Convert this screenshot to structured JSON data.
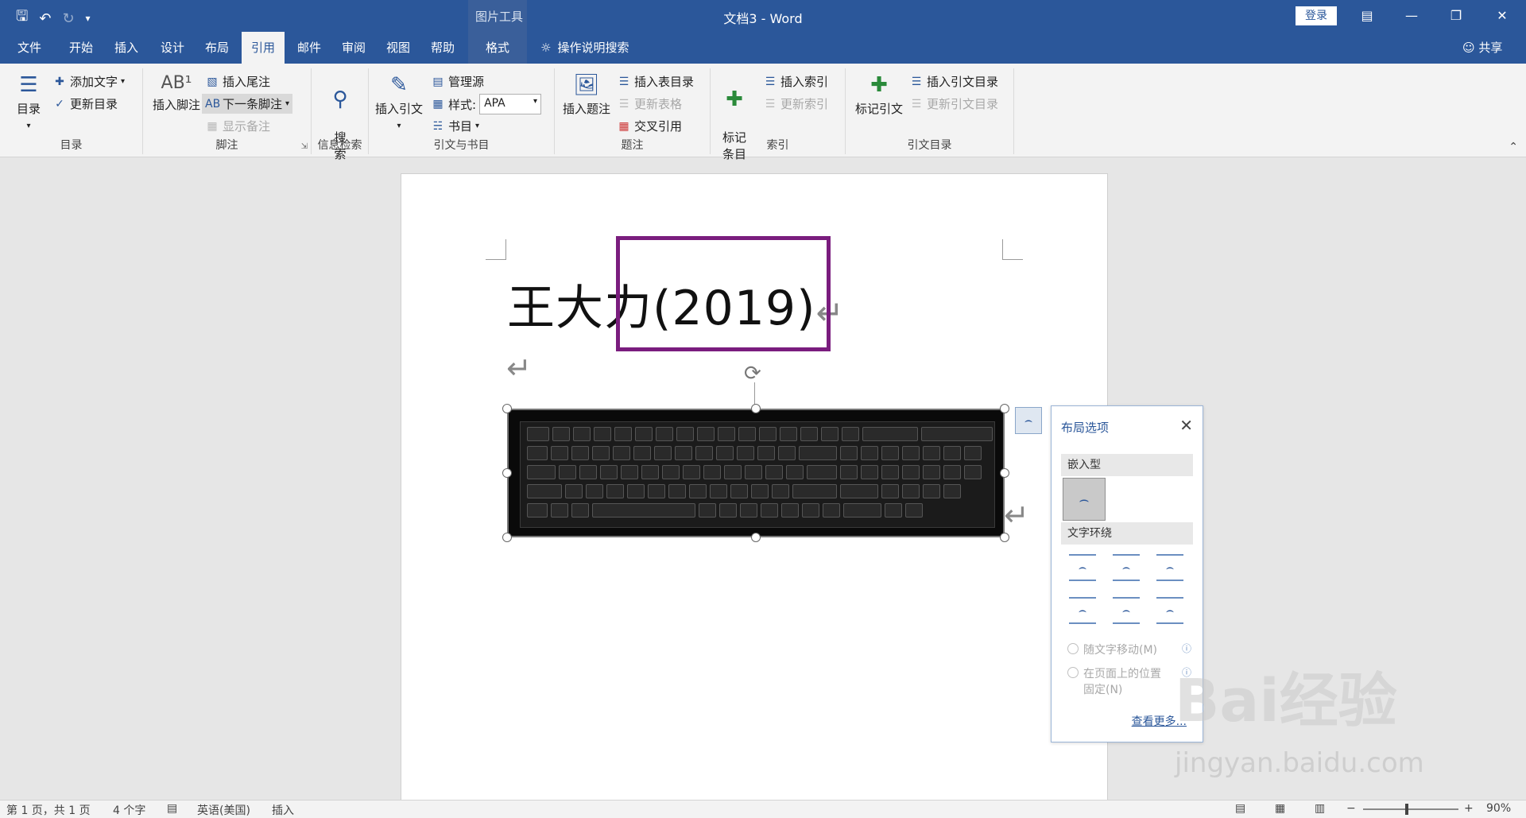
{
  "window": {
    "title": "文档3 - Word",
    "context_label": "图片工具",
    "login_label": "登录",
    "qat": [
      "save-icon",
      "undo-icon",
      "redo-icon",
      "customize-qat-icon"
    ]
  },
  "tabs": [
    {
      "label": "文件"
    },
    {
      "label": "开始"
    },
    {
      "label": "插入"
    },
    {
      "label": "设计"
    },
    {
      "label": "布局"
    },
    {
      "label": "引用"
    },
    {
      "label": "邮件"
    },
    {
      "label": "审阅"
    },
    {
      "label": "视图"
    },
    {
      "label": "帮助"
    },
    {
      "label": "格式"
    }
  ],
  "tell_me": "操作说明搜索",
  "share": "共享",
  "ribbon": {
    "toc": {
      "label": "目录",
      "big": "目录",
      "add_text": "添加文字",
      "update": "更新目录"
    },
    "footnote": {
      "label": "脚注",
      "insert_footnote": "插入脚注",
      "insert_endnote": "插入尾注",
      "next_footnote": "下一条脚注",
      "show_notes": "显示备注"
    },
    "research": {
      "label": "信息检索",
      "search": "搜\n索"
    },
    "citations": {
      "label": "引文与书目",
      "insert_citation": "插入引文",
      "manage_sources": "管理源",
      "style_label": "样式:",
      "style_value": "APA",
      "bibliography": "书目"
    },
    "captions": {
      "label": "题注",
      "insert_caption": "插入题注",
      "insert_table_of_figures": "插入表目录",
      "update_table": "更新表格",
      "cross_reference": "交叉引用"
    },
    "index": {
      "label": "索引",
      "mark_entry": "标记\n条目",
      "insert_index": "插入索引",
      "update_index": "更新索引"
    },
    "authorities": {
      "label": "引文目录",
      "mark_citation": "标记引文",
      "insert_toa": "插入引文目录",
      "update_toa": "更新引文目录"
    }
  },
  "document": {
    "heading": "王大力(2019)"
  },
  "layout_panel": {
    "title": "布局选项",
    "inline_section": "嵌入型",
    "wrap_section": "文字环绕",
    "move_with_text": "随文字移动(M)",
    "fix_position": "在页面上的位置\n固定(N)",
    "see_more": "查看更多..."
  },
  "status": {
    "page": "第 1 页，共 1 页",
    "words": "4 个字",
    "language": "英语(美国)",
    "mode": "插入",
    "zoom": "90%"
  },
  "watermark": {
    "brand": "Bai经验",
    "url": "jingyan.baidu.com"
  }
}
